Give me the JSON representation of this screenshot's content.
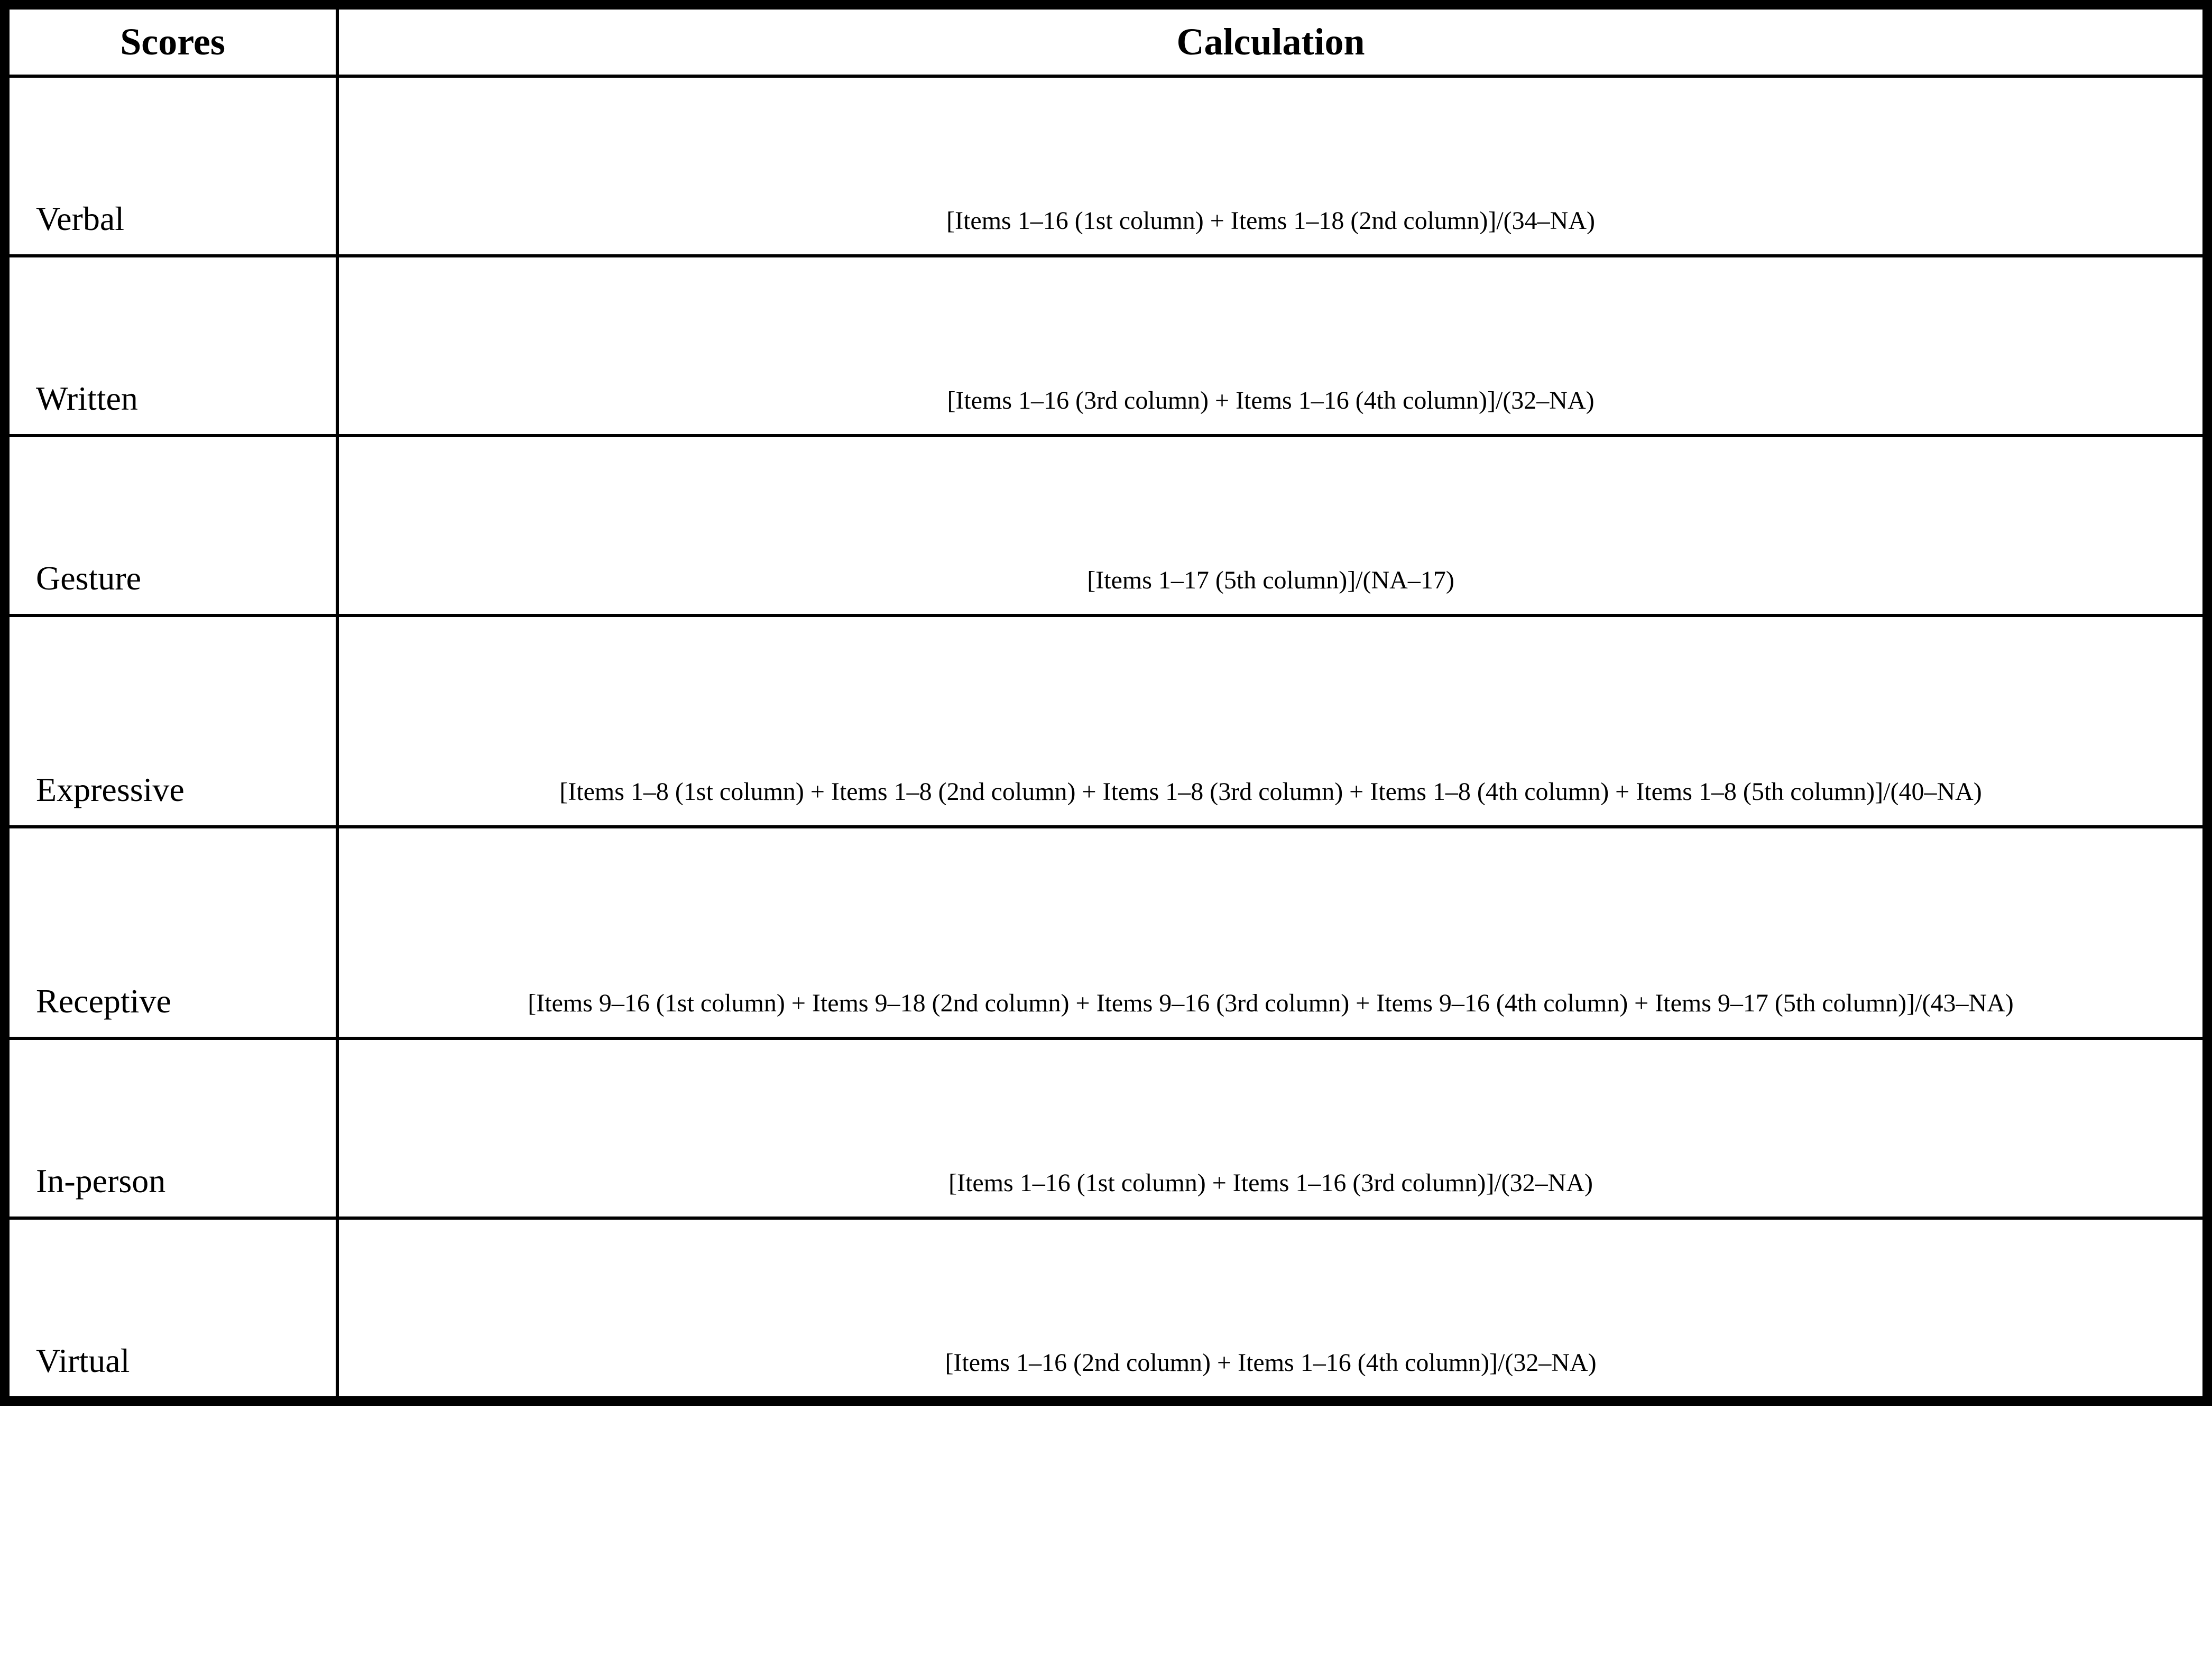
{
  "headers": {
    "scores": "Scores",
    "calculation": "Calculation"
  },
  "rows": [
    {
      "score": "Verbal",
      "calculation": "[Items 1–16 (1st column) + Items 1–18 (2nd column)]/(34–NA)"
    },
    {
      "score": "Written",
      "calculation": "[Items 1–16 (3rd column) + Items 1–16 (4th column)]/(32–NA)"
    },
    {
      "score": "Gesture",
      "calculation": "[Items 1–17 (5th column)]/(NA–17)"
    },
    {
      "score": "Expressive",
      "calculation": "[Items 1–8 (1st column) + Items 1–8 (2nd column) + Items 1–8 (3rd column) + Items 1–8 (4th column) + Items 1–8 (5th column)]/(40–NA)"
    },
    {
      "score": "Receptive",
      "calculation": "[Items 9–16 (1st column) + Items 9–18 (2nd column) + Items 9–16 (3rd column) + Items 9–16 (4th column) + Items 9–17 (5th column)]/(43–NA)"
    },
    {
      "score": "In-person",
      "calculation": "[Items 1–16 (1st column) + Items 1–16 (3rd column)]/(32–NA)"
    },
    {
      "score": "Virtual",
      "calculation": "[Items 1–16 (2nd column) + Items 1–16 (4th column)]/(32–NA)"
    }
  ]
}
